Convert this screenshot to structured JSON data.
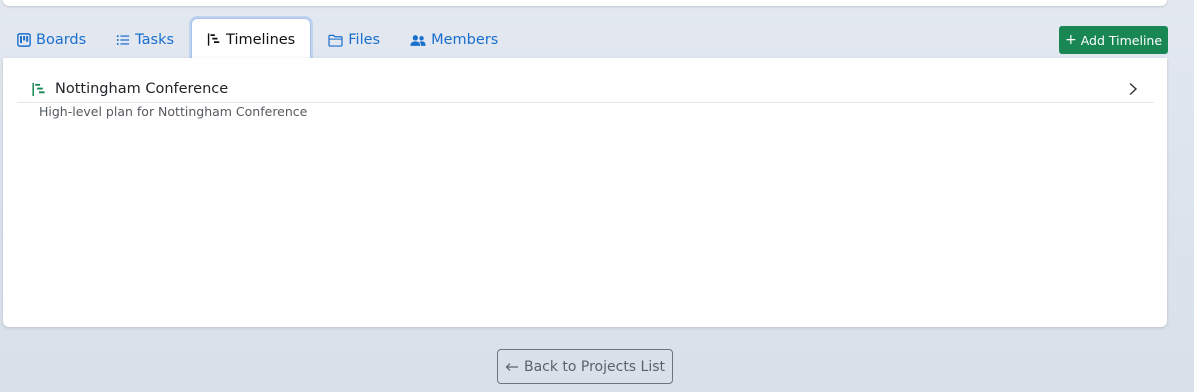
{
  "tabs": [
    {
      "label": "Boards",
      "icon": "kanban-icon",
      "active": false
    },
    {
      "label": "Tasks",
      "icon": "list-icon",
      "active": false
    },
    {
      "label": "Timelines",
      "icon": "timeline-icon",
      "active": true
    },
    {
      "label": "Files",
      "icon": "folder-icon",
      "active": false
    },
    {
      "label": "Members",
      "icon": "people-icon",
      "active": false
    }
  ],
  "actions": {
    "add_timeline_label": "Add Timeline",
    "add_icon": "plus-icon"
  },
  "timelines": [
    {
      "title": "Nottingham Conference",
      "description": "High-level plan for Nottingham Conference",
      "icon": "timeline-icon"
    }
  ],
  "footer": {
    "back_label": "Back to Projects List",
    "back_icon": "arrow-left-icon"
  },
  "colors": {
    "accent": "#1a6fce",
    "success": "#198754",
    "secondary": "#6c757d"
  }
}
